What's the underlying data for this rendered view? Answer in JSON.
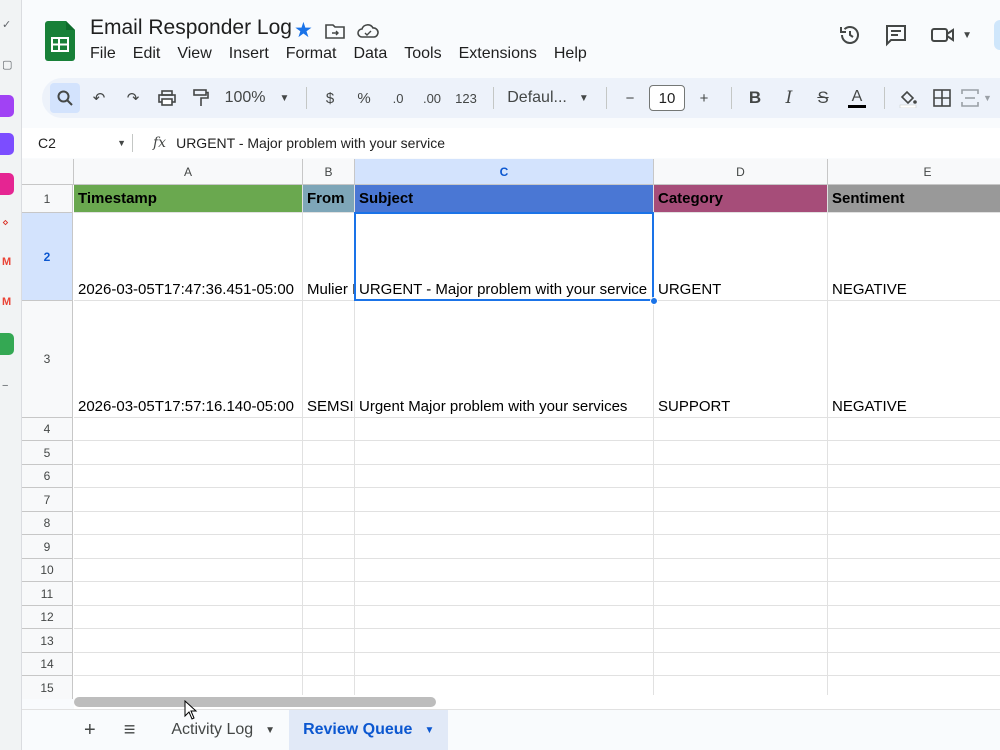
{
  "doc": {
    "title": "Email Responder Log"
  },
  "menu": [
    "File",
    "Edit",
    "View",
    "Insert",
    "Format",
    "Data",
    "Tools",
    "Extensions",
    "Help"
  ],
  "toolbar": {
    "zoom": "100%",
    "currency": "$",
    "percent": "%",
    "dec_decrease": ".0",
    "dec_increase": ".00",
    "number_format": "123",
    "font": "Defaul...",
    "minus": "−",
    "font_size": "10",
    "plus": "+",
    "bold": "B",
    "italic": "I",
    "strike": "S",
    "text_color": "A"
  },
  "formula_bar": {
    "cell_ref": "C2",
    "fx": "fx",
    "value": "URGENT - Major problem with your service"
  },
  "columns": [
    "A",
    "B",
    "C",
    "D",
    "E"
  ],
  "rows": [
    "1",
    "2",
    "3",
    "4",
    "5",
    "6",
    "7",
    "8",
    "9",
    "10",
    "11",
    "12",
    "13",
    "14",
    "15"
  ],
  "headers": [
    "Timestamp",
    "From",
    "Subject",
    "Category",
    "Sentiment"
  ],
  "header_colors": [
    "#6aa84f",
    "#7ea6b8",
    "#4a77d4",
    "#a64d79",
    "#999999"
  ],
  "data_rows": [
    [
      "2026-03-05T17:47:36.451-05:00",
      "Mulier I",
      "URGENT - Major problem with your service",
      "URGENT",
      "NEGATIVE"
    ],
    [
      "2026-03-05T17:57:16.140-05:00",
      "SEMSI",
      "Urgent Major problem with your services",
      "SUPPORT",
      "NEGATIVE"
    ]
  ],
  "sheets": {
    "add": "+",
    "list": "≡",
    "tabs": [
      "Activity Log",
      "Review Queue"
    ]
  },
  "icons": {
    "star": "star-icon",
    "move": "move-to-folder-icon",
    "cloud": "cloud-status-icon",
    "history": "history-icon",
    "comment": "comment-icon",
    "meet": "meet-icon"
  }
}
